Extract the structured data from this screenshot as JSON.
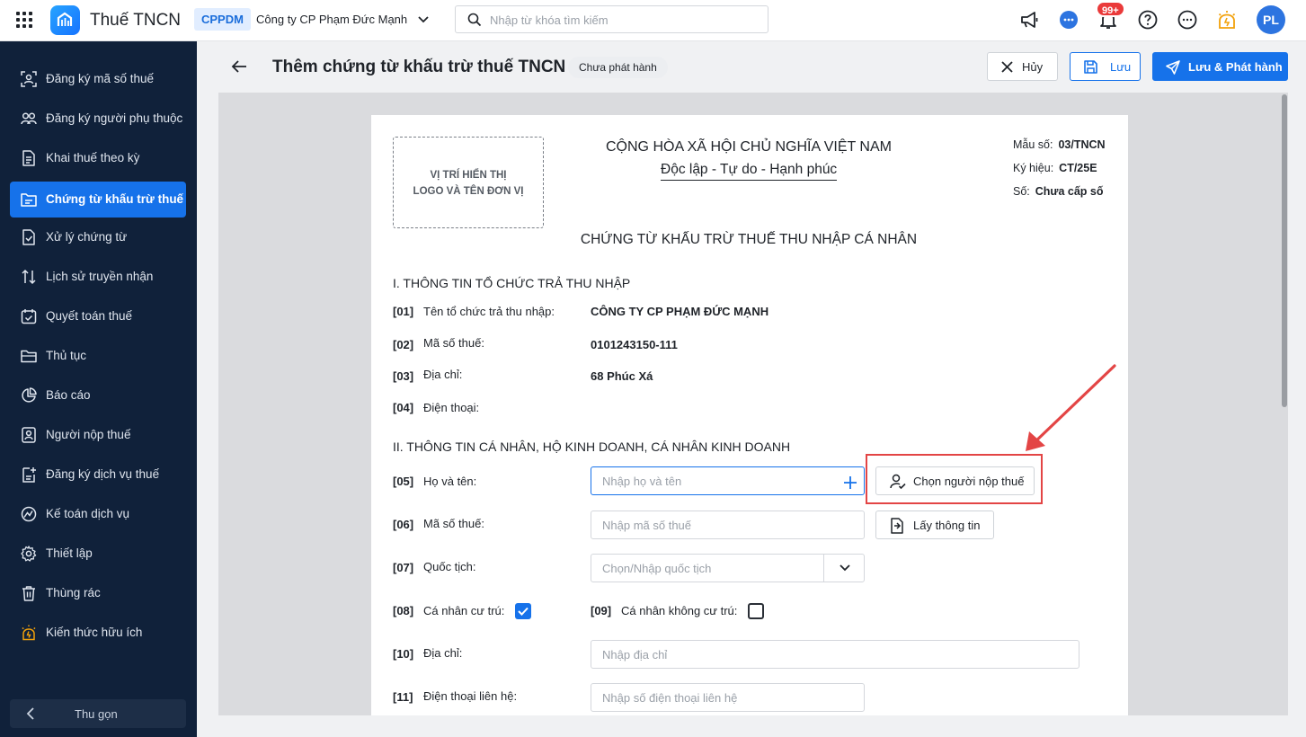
{
  "app": {
    "title": "Thuế TNCN"
  },
  "company": {
    "code": "CPPDM",
    "name": "Công ty CP Phạm Đức Mạnh"
  },
  "search": {
    "placeholder": "Nhập từ khóa tìm kiếm"
  },
  "topbar": {
    "notifications_count": "99+",
    "avatar_initials": "PL",
    "icons": [
      "megaphone-icon",
      "chat-icon",
      "bell-icon",
      "help-icon",
      "more-icon",
      "lightbulb-icon"
    ]
  },
  "sidebar": {
    "items": [
      {
        "label": "Đăng ký mã số thuế",
        "icon": "id-scan-icon"
      },
      {
        "label": "Đăng ký người phụ thuộc",
        "icon": "people-icon"
      },
      {
        "label": "Khai thuế theo kỳ",
        "icon": "document-icon"
      },
      {
        "label": "Chứng từ khấu trừ thuế",
        "icon": "folder-doc-icon",
        "active": true
      },
      {
        "label": "Xử lý chứng từ",
        "icon": "doc-check-icon"
      },
      {
        "label": "Lịch sử truyền nhận",
        "icon": "transfer-icon"
      },
      {
        "label": "Quyết toán thuế",
        "icon": "calendar-check-icon"
      },
      {
        "label": "Thủ tục",
        "icon": "folder-icon"
      },
      {
        "label": "Báo cáo",
        "icon": "pie-chart-icon"
      },
      {
        "label": "Người nộp thuế",
        "icon": "user-doc-icon"
      },
      {
        "label": "Đăng ký dịch vụ thuế",
        "icon": "doc-add-icon"
      },
      {
        "label": "Kế toán dịch vụ",
        "icon": "gauge-icon"
      },
      {
        "label": "Thiết lập",
        "icon": "gear-icon"
      },
      {
        "label": "Thùng rác",
        "icon": "trash-icon"
      },
      {
        "label": "Kiến thức hữu ích",
        "icon": "lightbulb-icon"
      }
    ],
    "collapse_label": "Thu gọn"
  },
  "header": {
    "title": "Thêm chứng từ khấu trừ thuế TNCN",
    "status": "Chưa phát hành",
    "cancel_label": "Hủy",
    "save_label": "Lưu",
    "publish_label": "Lưu & Phát hành"
  },
  "document": {
    "logo_placeholder_line1": "VỊ TRÍ HIỂN THỊ",
    "logo_placeholder_line2": "LOGO VÀ TÊN ĐƠN VỊ",
    "nation": "CỘNG HÒA XÃ HỘI CHỦ NGHĨA VIỆT NAM",
    "motto": "Độc lập - Tự do - Hạnh phúc",
    "meta": {
      "form_label": "Mẫu số:",
      "form_value": "03/TNCN",
      "symbol_label": "Ký hiệu:",
      "symbol_value": "CT/25E",
      "number_label": "Số:",
      "number_value": "Chưa cấp số"
    },
    "title": "CHỨNG TỪ KHẤU TRỪ THUẾ THU NHẬP CÁ NHÂN",
    "section1": {
      "heading": "I. THÔNG TIN TỔ CHỨC TRẢ THU NHẬP",
      "fields": [
        {
          "code": "[01]",
          "label": "Tên tổ chức trả thu nhập:",
          "value": "CÔNG TY CP PHẠM ĐỨC MẠNH"
        },
        {
          "code": "[02]",
          "label": "Mã số thuế:",
          "value": "0101243150-111"
        },
        {
          "code": "[03]",
          "label": "Địa chỉ:",
          "value": "68 Phúc Xá"
        },
        {
          "code": "[04]",
          "label": "Điện thoại:",
          "value": ""
        }
      ]
    },
    "section2": {
      "heading": "II. THÔNG TIN CÁ NHÂN, HỘ KINH DOANH, CÁ NHÂN KINH DOANH",
      "name": {
        "code": "[05]",
        "label": "Họ và tên:",
        "placeholder": "Nhập họ và tên",
        "value": ""
      },
      "choose_taxpayer_label": "Chọn người nộp thuế",
      "tax_code": {
        "code": "[06]",
        "label": "Mã số thuế:",
        "placeholder": "Nhập mã số thuế",
        "value": ""
      },
      "get_info_label": "Lấy thông tin",
      "nationality": {
        "code": "[07]",
        "label": "Quốc tịch:",
        "placeholder": "Chọn/Nhập quốc tịch"
      },
      "resident": {
        "code": "[08]",
        "label": "Cá nhân cư trú:",
        "checked": true
      },
      "non_resident": {
        "code": "[09]",
        "label": "Cá nhân không cư trú:",
        "checked": false
      },
      "address": {
        "code": "[10]",
        "label": "Địa chỉ:",
        "placeholder": "Nhập địa chỉ",
        "value": ""
      },
      "phone": {
        "code": "[11]",
        "label": "Điện thoại liên hệ:",
        "placeholder": "Nhập số điện thoại liên hệ",
        "value": ""
      }
    }
  },
  "colors": {
    "accent": "#1672ea",
    "sidebar_bg": "#10213a",
    "highlight": "#e34545"
  }
}
